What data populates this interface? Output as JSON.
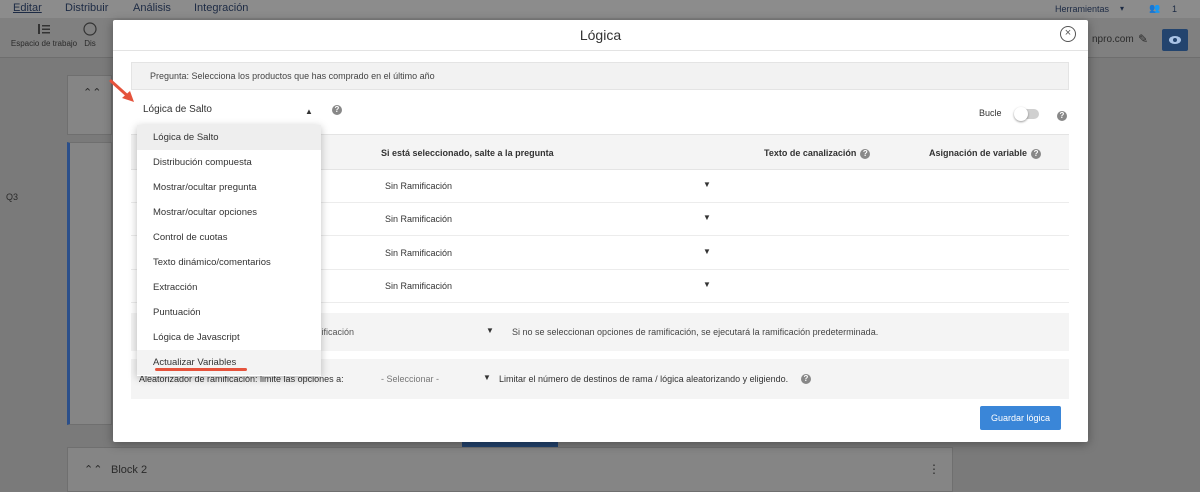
{
  "app": {
    "nav": [
      "Editar",
      "Distribuir",
      "Análisis",
      "Integración"
    ],
    "right_menu": "Herramientas",
    "user_count": "1",
    "domain_fragment": "npro.com",
    "toolbar": [
      "Espacio de trabajo",
      "Dis"
    ],
    "question_id": "Q3",
    "block2": "Block 2"
  },
  "modal": {
    "title": "Lógica",
    "close_label": "×",
    "question_label": "Pregunta: Selecciona los productos que has comprado en el último año",
    "logic_type_selected": "Lógica de Salto",
    "bucle_label": "Bucle",
    "columns": {
      "skip_to": "Si está seleccionado, salte a la pregunta",
      "piping_text": "Texto de canalización",
      "variable_assignment": "Asignación de variable"
    },
    "rows": [
      {
        "branch": "Sin Ramificación"
      },
      {
        "branch": "Sin Ramificación"
      },
      {
        "branch": "Sin Ramificación"
      },
      {
        "branch": "Sin Ramificación"
      }
    ],
    "default_branch_value": "mificación",
    "default_hint": "Si no se seleccionan opciones de ramificación, se ejecutará la ramificación predeterminada.",
    "randomizer_label": "Aleatorizador de ramificación: limite las opciones a:",
    "randomizer_select": "- Seleccionar -",
    "randomizer_hint": "Limitar el número de destinos de rama / lógica aleatorizando y eligiendo.",
    "save_button": "Guardar lógica"
  },
  "dropdown": {
    "options": [
      "Lógica de Salto",
      "Distribución compuesta",
      "Mostrar/ocultar pregunta",
      "Mostrar/ocultar opciones",
      "Control de cuotas",
      "Texto dinámico/comentarios",
      "Extracción",
      "Puntuación",
      "Lógica de Javascript",
      "Actualizar Variables"
    ],
    "selected_index": 0,
    "highlighted_index": 9
  },
  "colors": {
    "accent": "#3a86d8",
    "annotation": "#e5533c"
  }
}
